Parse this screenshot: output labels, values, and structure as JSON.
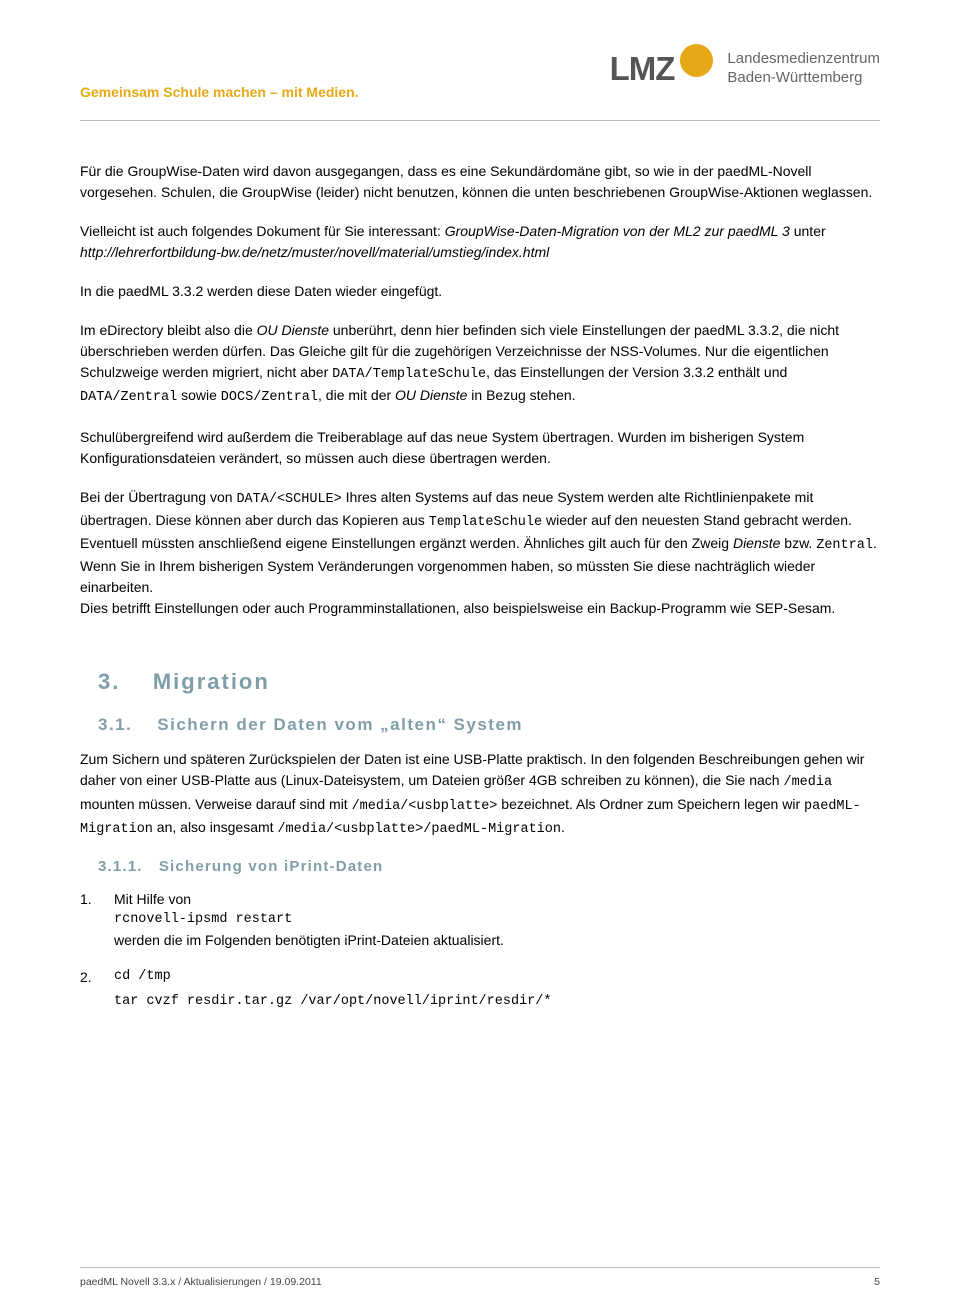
{
  "header": {
    "tagline": "Gemeinsam Schule machen – mit Medien.",
    "logo_text": "LMZ",
    "org_line1": "Landesmedienzentrum",
    "org_line2": "Baden-Württemberg"
  },
  "paragraphs": {
    "p1": "Für die GroupWise-Daten wird davon ausgegangen, dass es eine Sekundärdomäne gibt, so wie in der paedML-Novell vorgesehen. Schulen, die GroupWise (leider) nicht benutzen, können die unten beschriebenen GroupWise-Aktionen weglassen.",
    "p2_pre": "Vielleicht ist auch folgendes Dokument für Sie interessant: ",
    "p2_italic": "GroupWise-Daten-Migration von der ML2 zur paedML 3",
    "p2_mid": " unter ",
    "p2_url": "http://lehrerfortbildung-bw.de/netz/muster/novell/material/umstieg/index.html",
    "p3": "In die paedML 3.3.2 werden diese Daten wieder eingefügt.",
    "p4_a": "Im eDirectory bleibt also die ",
    "p4_ou": "OU Dienste",
    "p4_b": " unberührt, denn hier befinden sich viele Einstellungen der paedML 3.3.2, die nicht überschrieben werden dürfen. Das Gleiche gilt für die zugehörigen Verzeichnisse der NSS-Volumes. Nur die eigentlichen Schulzweige werden migriert, nicht aber ",
    "p4_m1": "DATA/TemplateSchule",
    "p4_c": ", das Einstellungen der Version 3.3.2 enthält und ",
    "p4_m2": "DATA/Zentral",
    "p4_d": " sowie ",
    "p4_m3": "DOCS/Zentral",
    "p4_e": ", die mit der ",
    "p4_ou2": "OU Dienste",
    "p4_f": " in Bezug stehen.",
    "p5": "Schulübergreifend wird außerdem die Treiberablage auf das neue System übertragen. Wurden im bisherigen System Konfigurationsdateien verändert, so müssen auch diese übertragen werden.",
    "p6_a": "Bei der Übertragung von ",
    "p6_m1": "DATA/<SCHULE>",
    "p6_b": " Ihres alten Systems auf das neue System werden alte Richtlinienpakete mit übertragen. Diese können aber durch das Kopieren aus ",
    "p6_m2": "TemplateSchule",
    "p6_c": " wieder auf den neuesten Stand gebracht werden. Eventuell müssten anschließend eigene Einstellungen ergänzt werden. Ähnliches gilt auch für den Zweig ",
    "p6_i1": "Dienste",
    "p6_d": " bzw. ",
    "p6_m3": "Zentral",
    "p6_e": ". Wenn Sie in Ihrem bisherigen System Veränderungen vorgenommen haben, so müssten Sie diese nachträglich wieder einarbeiten.",
    "p6_f": "Dies betrifft Einstellungen oder auch Programminstallationen, also beispielsweise ein Backup-Programm wie SEP-Sesam."
  },
  "headings": {
    "h2_num": "3.",
    "h2_text": "Migration",
    "h3_num": "3.1.",
    "h3_text": "Sichern der Daten vom „alten“ System",
    "h4_num": "3.1.1.",
    "h4_text": "Sicherung von iPrint-Daten"
  },
  "section31": {
    "p_a": "Zum Sichern und späteren Zurückspielen der Daten ist eine USB-Platte praktisch. In den folgenden Beschreibungen gehen wir daher von einer USB-Platte aus (Linux-Dateisystem, um Dateien größer 4GB schreiben zu können), die Sie nach ",
    "p_m1": "/media",
    "p_b": "  mounten  müssen. Verweise darauf sind mit ",
    "p_m2": "/media/<usbplatte>",
    "p_c": " bezeichnet. Als Ordner zum Speichern legen wir ",
    "p_m3": "paedML-Migration",
    "p_d": " an, also insgesamt ",
    "p_m4": "/media/<usbplatte>/paedML-Migration",
    "p_e": "."
  },
  "steps": {
    "s1_num": "1.",
    "s1_a": "Mit Hilfe von",
    "s1_cmd": "rcnovell-ipsmd restart",
    "s1_b": "werden  die im Folgenden benötigten iPrint-Dateien aktualisiert.",
    "s2_num": "2.",
    "s2_cmd1": "cd /tmp",
    "s2_cmd2": "tar cvzf resdir.tar.gz /var/opt/novell/iprint/resdir/*"
  },
  "footer": {
    "left": "paedML Novell 3.3.x / Aktualisierungen / 19.09.2011",
    "right": "5"
  }
}
